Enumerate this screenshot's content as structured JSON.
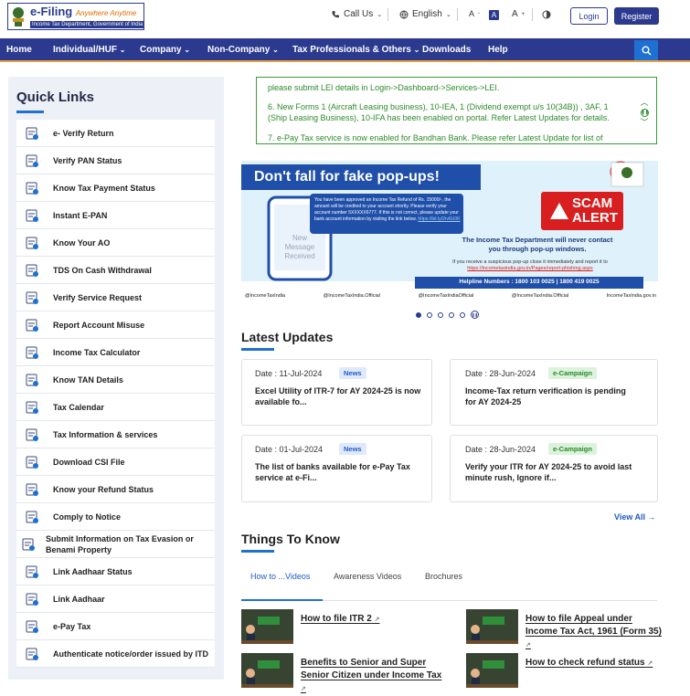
{
  "header": {
    "logo_title": "e-Filing",
    "logo_tagline": "Anywhere Anytime",
    "logo_subtitle": "Income Tax Department, Government of India",
    "call_us": "Call Us",
    "language": "English",
    "font_small": "A",
    "font_normal": "A",
    "font_large": "A",
    "login": "Login",
    "register": "Register"
  },
  "nav": {
    "items": [
      "Home",
      "Individual/HUF",
      "Company",
      "Non-Company",
      "Tax Professionals & Others",
      "Downloads",
      "Help"
    ]
  },
  "quick_links": {
    "title": "Quick Links",
    "items": [
      "e- Verify Return",
      "Verify PAN Status",
      "Know Tax Payment Status",
      "Instant E-PAN",
      "Know Your AO",
      "TDS On Cash Withdrawal",
      "Verify Service Request",
      "Report Account Misuse",
      "Income Tax Calculator",
      "Know TAN Details",
      "Tax Calendar",
      "Tax Information & services",
      "Download CSI File",
      "Know your Refund Status",
      "Comply to Notice",
      "Submit Information on Tax Evasion or Benami Property",
      "Link Aadhaar Status",
      "Link Aadhaar",
      "e-Pay Tax",
      "Authenticate notice/order issued by ITD"
    ]
  },
  "ticker": {
    "lines": [
      "please submit LEI details in Login->Dashboard->Services->LEI.",
      "6. New Forms 1 (Aircraft Leasing business), 10-IEA, 1 (Dividend exempt u/s 10(34B)) , 3AF, 1 (Ship Leasing Business), 10-IFA has been enabled on portal. Refer Latest Updates for details.",
      "7. e-Pay Tax service is now enabled for Bandhan Bank. Please refer Latest Update for list of"
    ]
  },
  "banner": {
    "headline": "Don't fall for fake pop-ups!",
    "sms": "You have been approved an Income Tax Refund of Rs. 15000/-, the amount will be credited to your account shortly. Please verify your account number 5XXXXX6777. If this is not correct, please update your bank account information by visiting the link below.",
    "sms_link": "https://bit.ly/2rv6U0K",
    "scam": "SCAM",
    "alert": "ALERT",
    "phone_text": "New Message Received",
    "note1": "The Income Tax Department will never contact",
    "note2": "you through pop-up windows.",
    "report": "If you receive a suspicious pop-up close it immediately and report it to",
    "report_link": "https://incometaxindia.gov.in/Pages/report-phishing.aspx",
    "helpline": "Helpline Numbers : 1800 103 0025 | 1800 419 0025",
    "social": [
      "@IncomeTaxIndia",
      "@IncomeTaxIndia.Official",
      "@IncomeTaxIndiaOfficial",
      "@IncomeTaxIndia.Official",
      "IncomeTaxIndia.gov.in"
    ]
  },
  "latest_updates": {
    "title": "Latest Updates",
    "cards": [
      {
        "date": "Date : 11-Jul-2024",
        "badge": "News",
        "text": "Excel Utility of ITR-7 for AY 2024-25 is now available fo..."
      },
      {
        "date": "Date : 28-Jun-2024",
        "badge": "e-Campaign",
        "text": "Income-Tax return verification is pending for AY 2024-25"
      },
      {
        "date": "Date : 01-Jul-2024",
        "badge": "News",
        "text": "The list of banks available for e-Pay Tax service at e-Fi..."
      },
      {
        "date": "Date : 28-Jun-2024",
        "badge": "e-Campaign",
        "text": "Verify your ITR for AY 2024-25 to avoid last minute rush, Ignore if..."
      }
    ],
    "view_all": "View All"
  },
  "things": {
    "title": "Things To Know",
    "tabs": [
      "How to ...Videos",
      "Awareness Videos",
      "Brochures"
    ],
    "videos": [
      "How to file ITR 2",
      "How to file Appeal under Income Tax Act, 1961 (Form 35)",
      "Benefits to Senior and Super Senior Citizen under Income Tax",
      "How to check refund status"
    ]
  },
  "colors": {
    "primary": "#2b3a8f",
    "accent": "#1e70d2",
    "ticker": "#2c8a2c",
    "orange": "#e8a33d"
  }
}
